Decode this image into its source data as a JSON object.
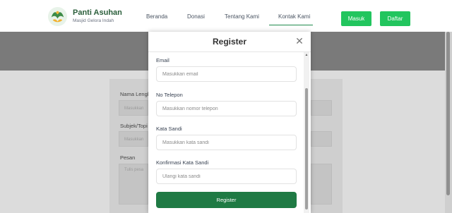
{
  "header": {
    "brand_title": "Panti Asuhan",
    "brand_subtitle": "Masjid Gelora Indah",
    "nav": [
      "Beranda",
      "Donasi",
      "Tentang Kami",
      "Kontak Kami"
    ],
    "active_nav": "Kontak Kami",
    "login_label": "Masuk",
    "register_label": "Daftar",
    "accent_color": "#22c55e"
  },
  "background_form": {
    "fields": [
      {
        "label": "Nama Lengk",
        "placeholder": "Masukkan"
      },
      {
        "label": "Subjek/Topi",
        "placeholder": "Masukkan"
      },
      {
        "label": "Pesan",
        "placeholder": "Tulis pesa"
      }
    ]
  },
  "modal": {
    "title": "Register",
    "close_icon": "close-icon",
    "fields": [
      {
        "label": "Email",
        "placeholder": "Masukkan email"
      },
      {
        "label": "No Telepon",
        "placeholder": "Masukkan nomor telepon"
      },
      {
        "label": "Kata Sandi",
        "placeholder": "Masukkan kata sandi"
      },
      {
        "label": "Konfirmasi Kata Sandi",
        "placeholder": "Ulangi kata sandi"
      }
    ],
    "submit_label": "Register",
    "submit_color": "#1f7a44"
  }
}
